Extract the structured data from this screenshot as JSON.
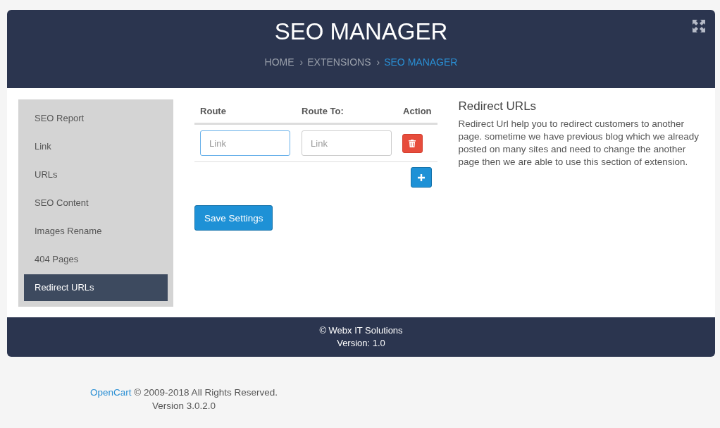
{
  "header": {
    "title": "SEO MANAGER",
    "breadcrumb": [
      {
        "label": "HOME",
        "selected": false
      },
      {
        "label": "EXTENSIONS",
        "separator": "›",
        "selected": false
      },
      {
        "label": "SEO MANAGER",
        "separator": "›",
        "selected": true
      }
    ]
  },
  "sidebar": {
    "items": [
      {
        "label": "SEO Report",
        "selected": false
      },
      {
        "label": "Link",
        "selected": false
      },
      {
        "label": "URLs",
        "selected": false
      },
      {
        "label": "SEO Content",
        "selected": false
      },
      {
        "label": "Images Rename",
        "selected": false
      },
      {
        "label": "404 Pages",
        "selected": false
      },
      {
        "label": "Redirect URLs",
        "selected": true
      }
    ]
  },
  "table": {
    "columns": [
      "Route",
      "Route To:",
      "Action"
    ],
    "rows": [
      {
        "fields": [
          {
            "placeholder": "Link",
            "focused": true
          },
          {
            "placeholder": "Link",
            "focused": false
          }
        ]
      }
    ]
  },
  "save_button": "Save Settings",
  "info": {
    "title": "Redirect URLs",
    "text": "Redirect Url help you to redirect customers to another page. sometime we have previous blog which we already posted on many sites and need to change the another page then we are able to use this section of extension."
  },
  "panel_footer": [
    "© Webx IT Solutions",
    "Version: 1.0"
  ],
  "page_footer": {
    "link": "OpenCart",
    "text": "© 2009-2018 All Rights Reserved.",
    "version": "Version 3.0.2.0"
  }
}
